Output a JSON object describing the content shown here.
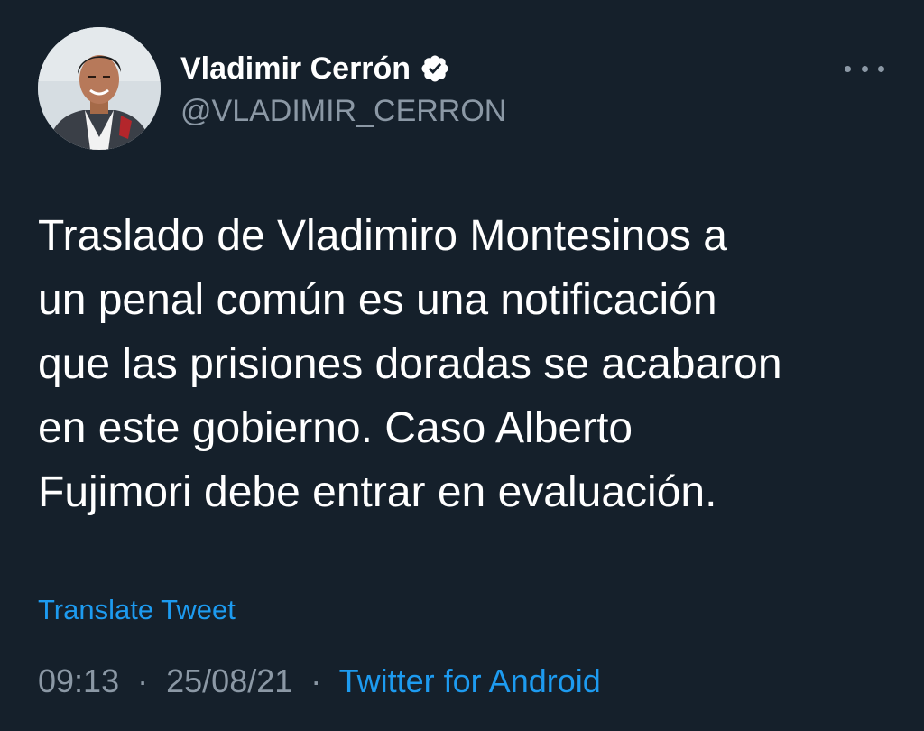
{
  "author": {
    "display_name": "Vladimir Cerrón",
    "handle": "@VLADIMIR_CERRON",
    "verified": true,
    "verified_icon": "verified-badge-icon",
    "avatar_icon": "profile-photo"
  },
  "tweet": {
    "text": "Traslado de Vladimiro Montesinos a\nun penal común es una notificación\nque las prisiones doradas se acabaron\nen este gobierno. Caso Alberto\nFujimori debe entrar en evaluación."
  },
  "actions": {
    "translate_label": "Translate Tweet",
    "more_icon": "more-options-icon"
  },
  "meta": {
    "time": "09:13",
    "date": "25/08/21",
    "separator": "·",
    "source": "Twitter for Android"
  },
  "colors": {
    "background": "#15202b",
    "accent": "#1d9bf0",
    "secondary_text": "#8b98a5",
    "primary_text": "#ffffff"
  }
}
